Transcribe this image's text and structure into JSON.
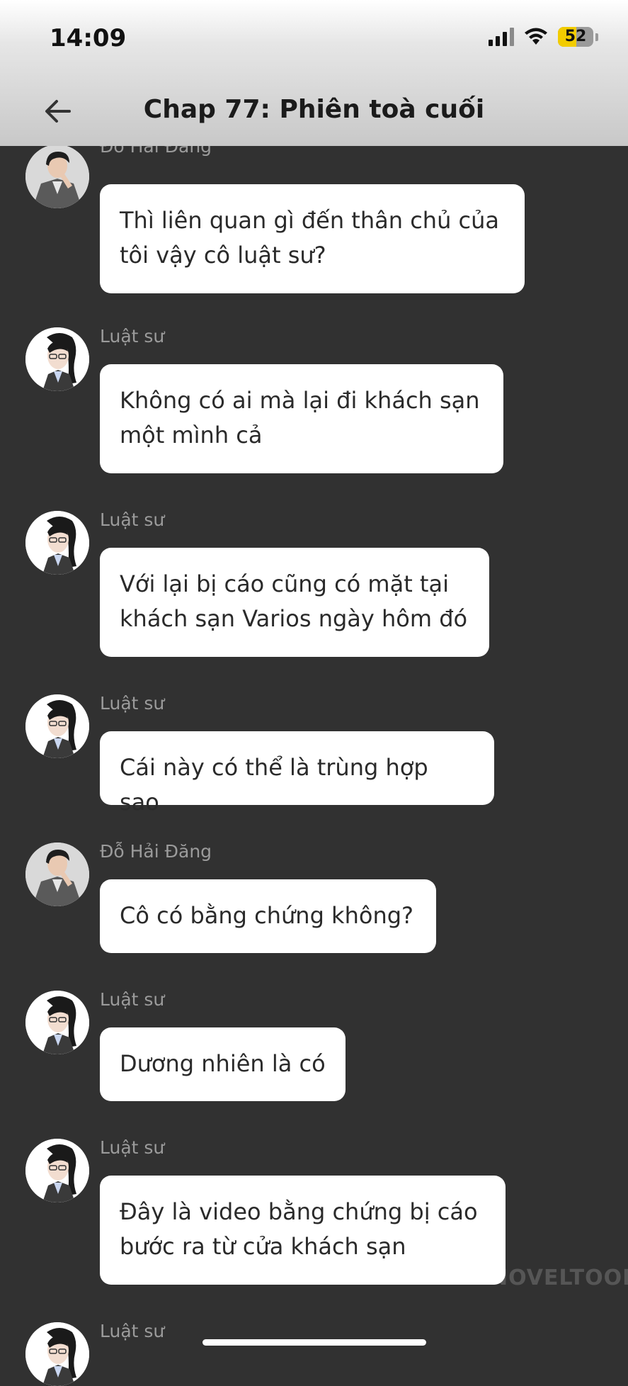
{
  "status_bar": {
    "time": "14:09",
    "battery": "52",
    "battery_level_percent": 52
  },
  "header": {
    "title": "Chap 77: Phiên toà cuối",
    "back_icon": "arrow-left-icon"
  },
  "messages": [
    {
      "sender": "Đỗ Hải Đăng",
      "text": "Thì liên quan gì đến thân chủ của tôi vậy cô luật sư?",
      "avatar": "male-character-avatar"
    },
    {
      "sender": "Luật sư",
      "text": "Không có ai mà lại đi khách sạn một mình cả",
      "avatar": "female-lawyer-avatar"
    },
    {
      "sender": "Luật sư",
      "text": "Với lại bị cáo cũng có mặt tại khách sạn Varios ngày hôm đó",
      "avatar": "female-lawyer-avatar"
    },
    {
      "sender": "Luật sư",
      "text": "Cái này có thể là trùng hợp sao",
      "avatar": "female-lawyer-avatar"
    },
    {
      "sender": "Đỗ Hải Đăng",
      "text": "Cô có bằng chứng không?",
      "avatar": "male-character-avatar"
    },
    {
      "sender": "Luật sư",
      "text": "Dương nhiên là có",
      "avatar": "female-lawyer-avatar"
    },
    {
      "sender": "Luật sư",
      "text": "Đây là video bằng chứng bị cáo bước ra từ cửa khách sạn",
      "avatar": "female-lawyer-avatar"
    },
    {
      "sender": "Luật sư",
      "text": "",
      "avatar": "female-lawyer-avatar"
    }
  ],
  "watermark": "NOVELTOON",
  "colors": {
    "background": "#313131",
    "bubble": "#ffffff",
    "sender_text": "#9b9b9b",
    "battery_fill": "#f2cc00"
  }
}
